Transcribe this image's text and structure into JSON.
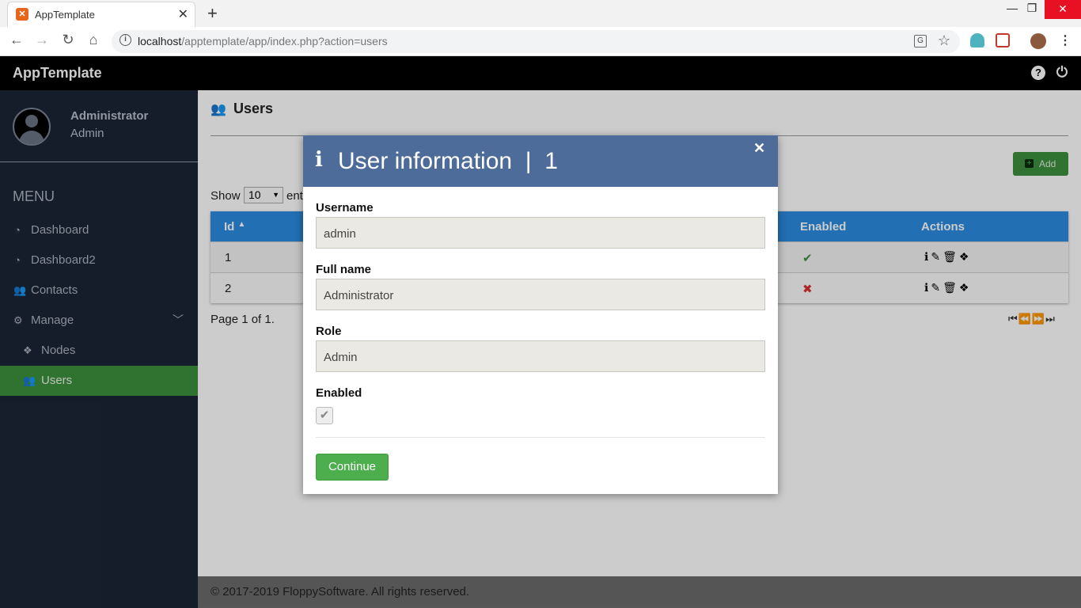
{
  "browser": {
    "tab_title": "AppTemplate",
    "url_host": "localhost",
    "url_path": "/apptemplate/app/index.php?action=users"
  },
  "app": {
    "brand": "AppTemplate"
  },
  "sidebar": {
    "user_name": "Administrator",
    "user_role": "Admin",
    "menu_title": "MENU",
    "items": [
      {
        "label": "Dashboard",
        "icon": "dashboard-icon"
      },
      {
        "label": "Dashboard2",
        "icon": "dashboard-icon"
      },
      {
        "label": "Contacts",
        "icon": "users-icon"
      },
      {
        "label": "Manage",
        "icon": "cogs-icon"
      },
      {
        "label": "Nodes",
        "icon": "cubes-icon"
      },
      {
        "label": "Users",
        "icon": "users-icon"
      }
    ]
  },
  "main": {
    "title": "Users",
    "add_label": "Add",
    "show_label": "Show",
    "show_value": "10",
    "show_suffix": "ent",
    "columns": {
      "id": "Id",
      "enabled": "Enabled",
      "actions": "Actions"
    },
    "rows": [
      {
        "id": "1",
        "enabled": "✔"
      },
      {
        "id": "2",
        "enabled": "✖"
      }
    ],
    "page_info": "Page 1 of 1.",
    "pager": "⏮⏪⏩⏭"
  },
  "footer": {
    "text": "© 2017-2019 FloppySoftware. All rights reserved."
  },
  "modal": {
    "title": "User information  |  1",
    "username_label": "Username",
    "username_value": "admin",
    "fullname_label": "Full name",
    "fullname_value": "Administrator",
    "role_label": "Role",
    "role_value": "Admin",
    "enabled_label": "Enabled",
    "continue_label": "Continue"
  },
  "colors": {
    "sidebar_bg": "#1b2536",
    "active_green": "#3c8f3c",
    "table_header": "#2b8be0",
    "modal_header": "#4e6c99"
  }
}
